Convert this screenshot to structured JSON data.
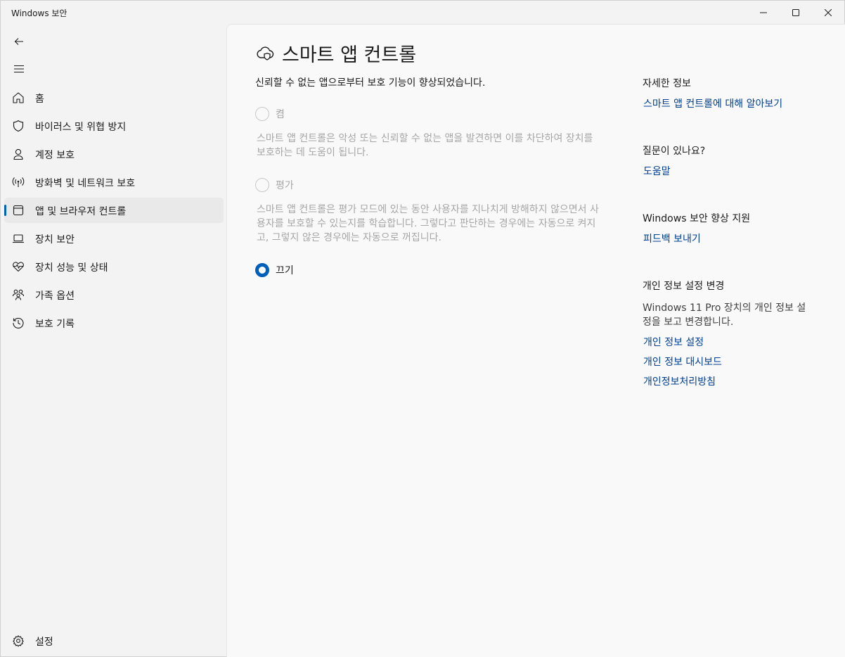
{
  "window": {
    "title": "Windows 보안"
  },
  "sidebar": {
    "back_icon": "back-arrow-icon",
    "menu_icon": "hamburger-menu-icon",
    "items": [
      {
        "label": "홈",
        "icon": "home-icon"
      },
      {
        "label": "바이러스 및 위협 방지",
        "icon": "shield-icon"
      },
      {
        "label": "계정 보호",
        "icon": "person-icon"
      },
      {
        "label": "방화벽 및 네트워크 보호",
        "icon": "wireless-signal-icon"
      },
      {
        "label": "앱 및 브라우저 컨트롤",
        "icon": "app-window-icon",
        "active": true
      },
      {
        "label": "장치 보안",
        "icon": "laptop-icon"
      },
      {
        "label": "장치 성능 및 상태",
        "icon": "heart-pulse-icon"
      },
      {
        "label": "가족 옵션",
        "icon": "family-icon"
      },
      {
        "label": "보호 기록",
        "icon": "history-clock-icon"
      }
    ],
    "settings_label": "설정"
  },
  "main": {
    "title": "스마트 앱 컨트롤",
    "description": "신뢰할 수 없는 앱으로부터 보호 기능이 향상되었습니다.",
    "options": [
      {
        "label": "켬",
        "description": "스마트 앱 컨트롤은 악성 또는 신뢰할 수 없는 앱을 발견하면 이를 차단하여 장치를 보호하는 데 도움이 됩니다.",
        "selected": false,
        "disabled": true
      },
      {
        "label": "평가",
        "description": "스마트 앱 컨트롤은 평가 모드에 있는 동안 사용자를 지나치게 방해하지 않으면서 사용자를 보호할 수 있는지를 학습합니다. 그렇다고 판단하는 경우에는 자동으로 켜지고, 그렇지 않은 경우에는 자동으로 꺼집니다.",
        "selected": false,
        "disabled": true
      },
      {
        "label": "끄기",
        "description": "",
        "selected": true,
        "disabled": false
      }
    ]
  },
  "side": {
    "info_heading": "자세한 정보",
    "info_link": "스마트 앱 컨트롤에 대해 알아보기",
    "question_heading": "질문이 있나요?",
    "help_link": "도움말",
    "improve_heading": "Windows 보안 향상 지원",
    "feedback_link": "피드백 보내기",
    "privacy_heading": "개인 정보 설정 변경",
    "privacy_text": "Windows 11 Pro 장치의 개인 정보 설정을 보고 변경합니다.",
    "privacy_links": [
      "개인 정보 설정",
      "개인 정보 대시보드",
      "개인정보처리방침"
    ]
  },
  "colors": {
    "accent": "#005fb8",
    "link": "#003e92",
    "disabled_text": "#a6a6a6"
  }
}
